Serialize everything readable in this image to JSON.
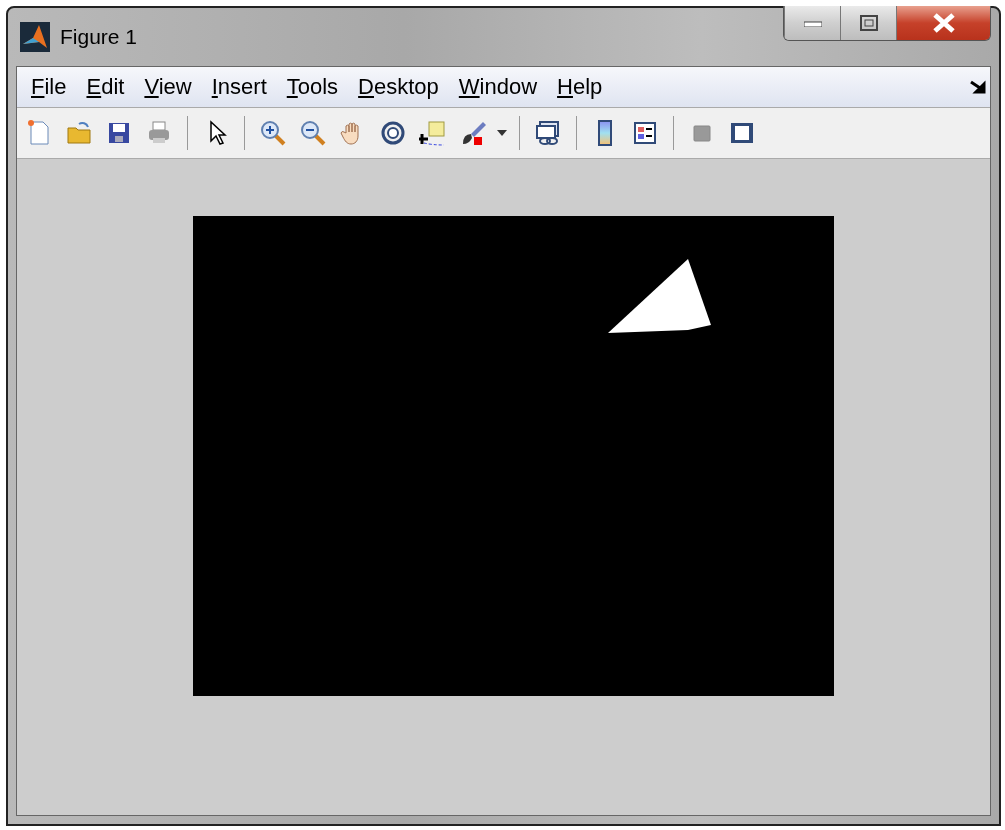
{
  "window": {
    "title": "Figure 1"
  },
  "menu": [
    "File",
    "Edit",
    "View",
    "Insert",
    "Tools",
    "Desktop",
    "Window",
    "Help"
  ]
}
